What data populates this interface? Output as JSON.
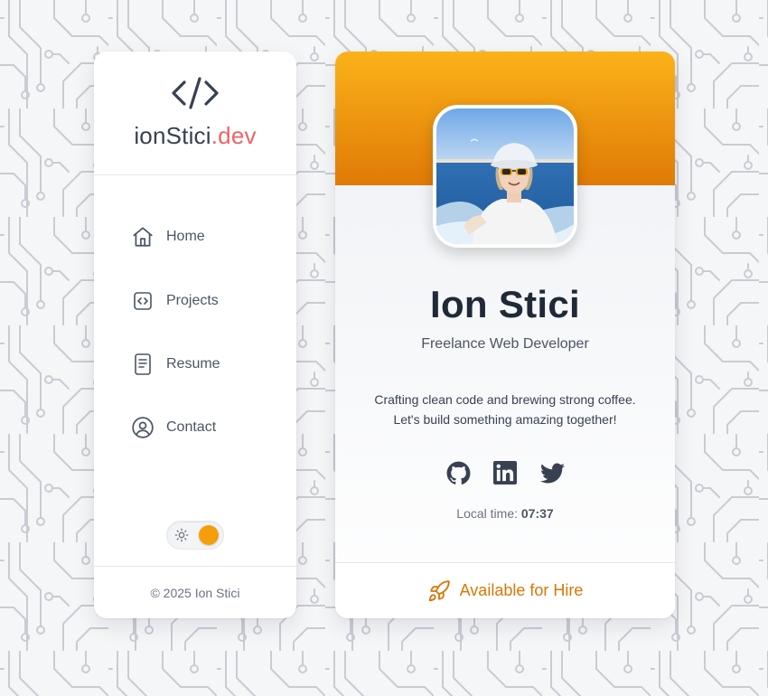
{
  "brand": {
    "icon": "code-brackets-icon",
    "name_main": "ionStici",
    "name_accent": ".dev",
    "accent_color": "#ef6363"
  },
  "sidebar": {
    "items": [
      {
        "label": "Home",
        "icon": "home-icon"
      },
      {
        "label": "Projects",
        "icon": "code-file-icon"
      },
      {
        "label": "Resume",
        "icon": "document-icon"
      },
      {
        "label": "Contact",
        "icon": "user-circle-icon"
      }
    ],
    "theme_toggle": {
      "icon": "sun-icon",
      "state": "light"
    },
    "footer": "© 2025 Ion Stici"
  },
  "profile": {
    "avatar": "profile-photo",
    "name": "Ion Stici",
    "role": "Freelance Web Developer",
    "bio_line1": "Crafting clean code and brewing strong coffee.",
    "bio_line2": "Let's build something amazing together!",
    "socials": [
      {
        "name": "GitHub",
        "icon": "github-icon"
      },
      {
        "name": "LinkedIn",
        "icon": "linkedin-icon"
      },
      {
        "name": "Twitter",
        "icon": "twitter-icon"
      }
    ],
    "local_time_label": "Local time:",
    "local_time_value": "07:37",
    "hire_label": "Available for Hire",
    "hire_icon": "rocket-icon"
  },
  "colors": {
    "banner_top": "#fbb21a",
    "banner_bottom": "#e07a06",
    "hire": "#d97706",
    "toggle_knob": "#f59e0b"
  }
}
